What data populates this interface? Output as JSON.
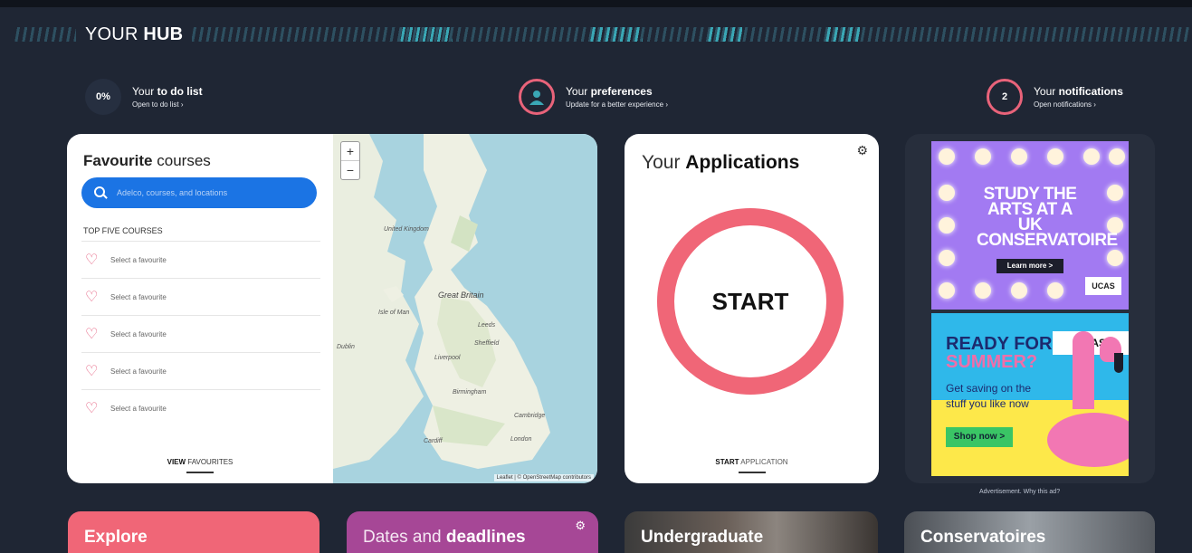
{
  "hub": {
    "title_pre": "YOUR",
    "title_bold": "HUB"
  },
  "summary": {
    "todo": {
      "circle": "0%",
      "pre": "Your",
      "bold": "to do list",
      "link": "Open to do list"
    },
    "preferences": {
      "icon": "person-icon",
      "pre": "Your",
      "bold": "preferences",
      "link": "Update for a better experience"
    },
    "notifications": {
      "circle": "2",
      "pre": "Your",
      "bold": "notifications",
      "link": "Open notifications"
    }
  },
  "favourites": {
    "title_bold": "Favourite",
    "title_rest": "courses",
    "search_placeholder": "Adelco, courses, and locations",
    "top_heading": "TOP FIVE COURSES",
    "items": [
      "Select a favourite",
      "Select a favourite",
      "Select a favourite",
      "Select a favourite",
      "Select a favourite"
    ],
    "view_bold": "VIEW",
    "view_rest": "FAVOURITES"
  },
  "map": {
    "zoom_in": "+",
    "zoom_out": "−",
    "labels": {
      "uk": "United Kingdom",
      "gb": "Great Britain",
      "iom": "Isle of Man",
      "leeds": "Leeds",
      "sheffield": "Sheffield",
      "liverpool": "Liverpool",
      "birmingham": "Birmingham",
      "dublin": "Dublin",
      "cardiff": "Cardiff",
      "london": "London",
      "cambridge": "Cambridge"
    },
    "attribution": "Leaflet | © OpenStreetMap contributors"
  },
  "applications": {
    "title_pre": "Your",
    "title_bold": "Applications",
    "start": "START",
    "link_bold": "START",
    "link_rest": "APPLICATION"
  },
  "ads": {
    "ad1": {
      "headline": "STUDY THE ARTS AT A UK CONSERVATOIRE",
      "button": "Learn more >",
      "logo": "UCAS"
    },
    "ad2": {
      "line1": "READY FOR",
      "line2": "SUMMER?",
      "body": "Get saving on the stuff you like now",
      "button": "Shop now >",
      "logo": "UCAS"
    },
    "caption": "Advertisement. Why this ad?"
  },
  "tiles": {
    "explore": "Explore",
    "dates_pre": "Dates and",
    "dates_bold": "deadlines",
    "undergraduate": "Undergraduate",
    "conservatoires": "Conservatoires"
  },
  "colors": {
    "background": "#1f2634",
    "accent_pink": "#f06677",
    "purple": "#a64796",
    "search_blue": "#1b74e4"
  }
}
